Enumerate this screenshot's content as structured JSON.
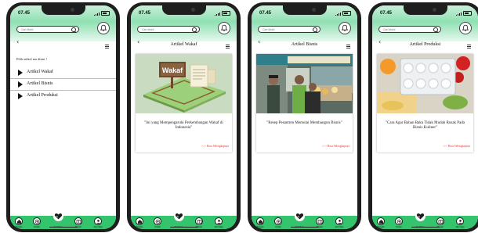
{
  "status": {
    "time": "07.45"
  },
  "search": {
    "placeholder": "Cari disini"
  },
  "nav": {
    "home": "Beranda",
    "donasi": "Donasi",
    "kontribusi": "Kontribusi",
    "bacaan": "Bacaan",
    "akun": "Akun Saya"
  },
  "screens": [
    {
      "title": "",
      "prompt": "Pilih artikel mu disini !",
      "items": [
        {
          "label": "Artikel Wakaf"
        },
        {
          "label": "Artikel Bisnis"
        },
        {
          "label": "Artikel Produksi"
        }
      ]
    },
    {
      "title": "Artikel Wakaf",
      "image": "wakaf-illustration",
      "image_text": "Wakaf",
      "headline": "\"Ini yang Mempengaruhi Perkembangan Wakaf di Indonesia\"",
      "more": ">>> Baca Selengkapnya"
    },
    {
      "title": "Artikel Bisnis",
      "image": "pesantren-photo",
      "headline": "\"Resep Pesantren Memulai Membangun Bisnis\"",
      "more": ">>> Baca Selengkapnya"
    },
    {
      "title": "Artikel Produksi",
      "image": "food-ingredients-photo",
      "headline": "\"Cara Agar Bahan Baku Tidak Mudah Rusak Pada Bisnis Kuliner\"",
      "more": ">>> Baca Selengkapnya"
    }
  ],
  "colors": {
    "header_green": "#8fe0b2",
    "nav_green": "#35c46e",
    "link_red": "#e53935"
  }
}
